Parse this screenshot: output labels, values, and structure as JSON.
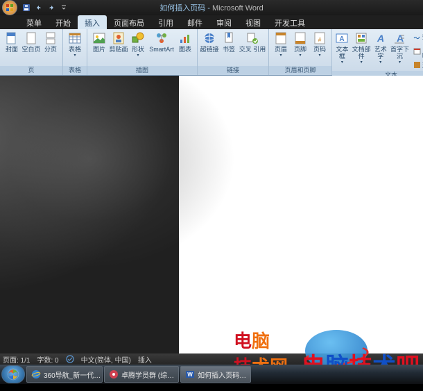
{
  "title": {
    "doc": "如何插入页码",
    "app": "Microsoft Word"
  },
  "qat": [
    "save",
    "undo",
    "redo"
  ],
  "tabs": [
    "菜单",
    "开始",
    "插入",
    "页面布局",
    "引用",
    "邮件",
    "审阅",
    "视图",
    "开发工具"
  ],
  "active_tab": 2,
  "ribbon": {
    "groups": [
      {
        "label": "页",
        "items": [
          {
            "name": "cover-page",
            "label": "封面",
            "icon": "page-blue"
          },
          {
            "name": "blank-page",
            "label": "空白页",
            "icon": "page-white"
          },
          {
            "name": "page-break",
            "label": "分页",
            "icon": "page-break"
          }
        ]
      },
      {
        "label": "表格",
        "items": [
          {
            "name": "table",
            "label": "表格",
            "icon": "table",
            "drop": true
          }
        ]
      },
      {
        "label": "插图",
        "items": [
          {
            "name": "picture",
            "label": "图片",
            "icon": "picture"
          },
          {
            "name": "clipart",
            "label": "剪贴画",
            "icon": "clipart"
          },
          {
            "name": "shapes",
            "label": "形状",
            "icon": "shapes",
            "drop": true
          },
          {
            "name": "smartart",
            "label": "SmartArt",
            "icon": "smartart"
          },
          {
            "name": "chart",
            "label": "图表",
            "icon": "chart"
          }
        ]
      },
      {
        "label": "链接",
        "items": [
          {
            "name": "hyperlink",
            "label": "超链接",
            "icon": "link"
          },
          {
            "name": "bookmark",
            "label": "书签",
            "icon": "bookmark"
          },
          {
            "name": "cross-ref",
            "label": "交叉\n引用",
            "icon": "crossref"
          }
        ]
      },
      {
        "label": "页眉和页脚",
        "items": [
          {
            "name": "header",
            "label": "页眉",
            "icon": "header",
            "drop": true
          },
          {
            "name": "footer",
            "label": "页脚",
            "icon": "footer",
            "drop": true
          },
          {
            "name": "page-number",
            "label": "页码",
            "icon": "pagenum",
            "drop": true
          }
        ]
      },
      {
        "label": "文本",
        "items": [
          {
            "name": "text-box",
            "label": "文本框",
            "icon": "textbox",
            "drop": true
          },
          {
            "name": "quick-parts",
            "label": "文档部件",
            "icon": "parts",
            "drop": true
          },
          {
            "name": "word-art",
            "label": "艺术字",
            "icon": "wordart",
            "drop": true
          },
          {
            "name": "drop-cap",
            "label": "首字下沉",
            "icon": "dropcap",
            "drop": true
          }
        ],
        "side": [
          {
            "name": "signature",
            "label": "签名行",
            "icon": "sig"
          },
          {
            "name": "date-time",
            "label": "日期和时间",
            "icon": "date"
          },
          {
            "name": "object",
            "label": "对象",
            "icon": "obj"
          }
        ]
      }
    ]
  },
  "status": {
    "page": "页面: 1/1",
    "words": "字数: 0",
    "lang": "中文(简体, 中国)",
    "mode": "插入"
  },
  "taskbar": [
    {
      "name": "ie",
      "label": "360导航_新一代…"
    },
    {
      "name": "app2",
      "label": "卓腾学员群 (综…"
    },
    {
      "name": "word",
      "label": "如何插入页码…",
      "active": true
    }
  ],
  "watermark1": "电脑\n技术网",
  "watermark2": "电脑技术吧"
}
